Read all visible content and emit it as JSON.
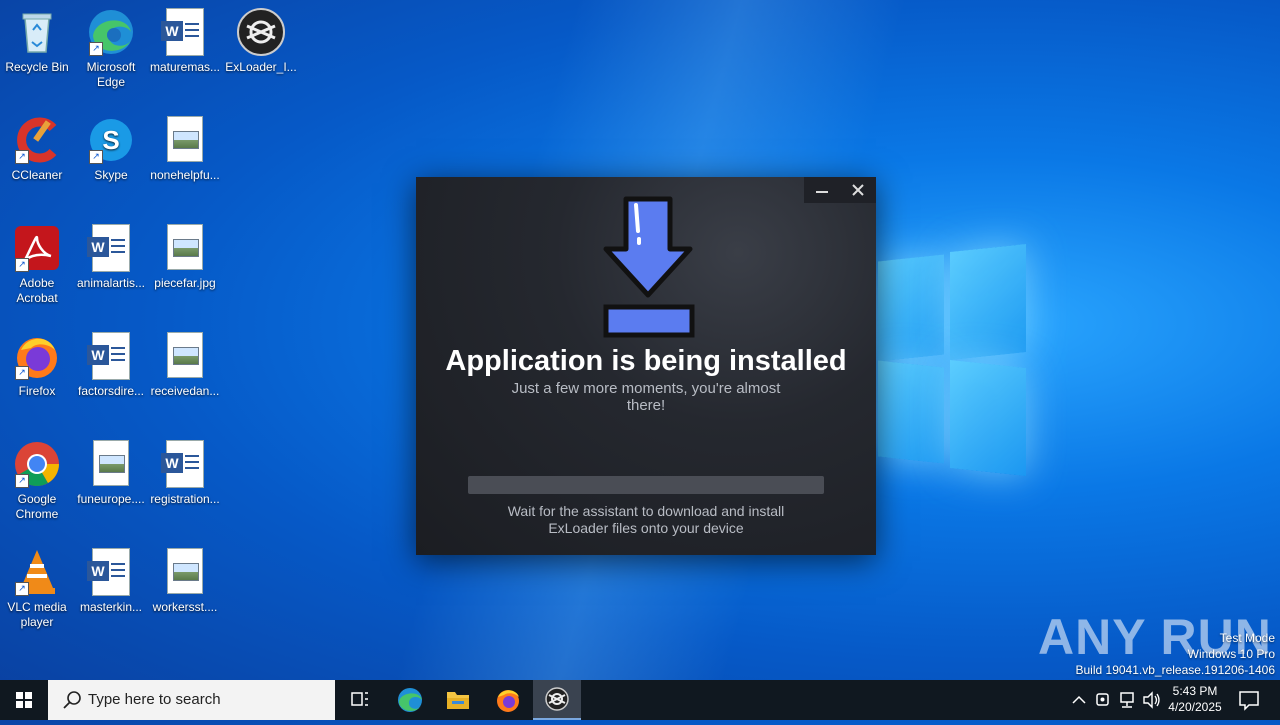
{
  "desktop": {
    "icons": [
      {
        "label": "Recycle Bin"
      },
      {
        "label": "Microsoft Edge"
      },
      {
        "label": "maturemas..."
      },
      {
        "label": "ExLoader_I..."
      },
      {
        "label": "CCleaner"
      },
      {
        "label": "Skype"
      },
      {
        "label": "nonehelpfu..."
      },
      {
        "label": "Adobe Acrobat"
      },
      {
        "label": "animalartis..."
      },
      {
        "label": "piecefar.jpg"
      },
      {
        "label": "Firefox"
      },
      {
        "label": "factorsdire..."
      },
      {
        "label": "receivedan..."
      },
      {
        "label": "Google Chrome"
      },
      {
        "label": "funeurope...."
      },
      {
        "label": "registration..."
      },
      {
        "label": "VLC media player"
      },
      {
        "label": "masterkin..."
      },
      {
        "label": "workersst...."
      }
    ]
  },
  "installer": {
    "title": "Application is being installed",
    "subtitle": "Just a few more moments, you're almost there!",
    "progress_fraction": 0.0,
    "footer": "Wait for the assistant to download and install ExLoader files onto your device",
    "accent_color": "#5b7cf0"
  },
  "watermark": {
    "brand": "ANY RUN",
    "line1": "Test Mode",
    "line2": "Windows 10 Pro",
    "line3": "Build 19041.vb_release.191206-1406"
  },
  "taskbar": {
    "search_placeholder": "Type here to search",
    "time": "5:43 PM",
    "date": "4/20/2025",
    "pinned": [
      "task-view",
      "edge",
      "file-explorer",
      "firefox",
      "exloader"
    ]
  }
}
